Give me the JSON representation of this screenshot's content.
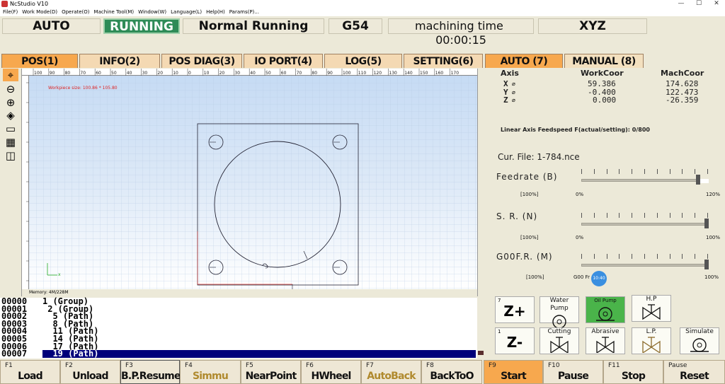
{
  "window": {
    "title": "NcStudio V10"
  },
  "menu": [
    "File(F)",
    "Work Mode(D)",
    "Operate(O)",
    "Machine Tool(M)",
    "Window(W)",
    "Language(L)",
    "Help(H)",
    "Params(P)..."
  ],
  "status": {
    "mode": "AUTO",
    "state": "RUNNING",
    "state_detail": "Normal Running",
    "coord": "G54",
    "time_label": "machining time",
    "time_value": "00:00:15",
    "axes": "XYZ"
  },
  "tabs_left": [
    "POS(1)",
    "INFO(2)",
    "POS DIAG(3)",
    "IO PORT(4)",
    "LOG(5)",
    "SETTING(6)"
  ],
  "tabs_right": [
    "AUTO (7)",
    "MANUAL (8)"
  ],
  "ruler_labels": [
    "100",
    "90",
    "80",
    "70",
    "60",
    "50",
    "40",
    "30",
    "20",
    "10",
    "0",
    "10",
    "20",
    "30",
    "40",
    "50",
    "60",
    "70",
    "80",
    "90",
    "100",
    "110",
    "120",
    "130",
    "140",
    "150",
    "160",
    "170"
  ],
  "canvas": {
    "workpiece": "Workpiece size: 100.86 * 105.80",
    "memory": "Memory: 4M/228M",
    "axis_x": "x"
  },
  "code_lines": [
    {
      "n": "00000",
      "t": "1 (Group)"
    },
    {
      "n": "00001",
      "t": " 2 (Group)"
    },
    {
      "n": "00002",
      "t": "  5 (Path)"
    },
    {
      "n": "00003",
      "t": "  8 (Path)"
    },
    {
      "n": "00004",
      "t": "  11 (Path)"
    },
    {
      "n": "00005",
      "t": "  14 (Path)"
    },
    {
      "n": "00006",
      "t": "  17 (Path)"
    },
    {
      "n": "00007",
      "t": "  19 (Path)"
    }
  ],
  "coords": {
    "h_axis": "Axis",
    "h_work": "WorkCoor",
    "h_mach": "MachCoor",
    "rows": [
      {
        "axis": "X",
        "work": "59.386",
        "mach": "174.628"
      },
      {
        "axis": "Y",
        "work": "-0.400",
        "mach": "122.473"
      },
      {
        "axis": "Z",
        "work": "0.000",
        "mach": "-26.359"
      }
    ]
  },
  "feed_info": "Linear Axis Feedspeed F(actual/setting):  0/800",
  "cur_file": "Cur. File: 1-784.nce",
  "sliders": [
    {
      "label": "Feedrate (B)",
      "left": "[100%]",
      "min": "0%",
      "max": "120%",
      "level": 0.93
    },
    {
      "label": "S. R. (N)",
      "left": "[100%]",
      "min": "0%",
      "max": "100%",
      "level": 1.0
    },
    {
      "label": "G00F.R. (M)",
      "left": "[100%]",
      "min": "G00 Fr",
      "max": "100%",
      "level": 1.0
    }
  ],
  "badge": "10:40",
  "buttons": {
    "zplus": {
      "num": "7",
      "label": "Z+"
    },
    "zminus": {
      "num": "1",
      "label": "Z-"
    },
    "water": "Water Pump",
    "oil": "Oil Pump",
    "hp": "H.P",
    "cutting": "Cutting",
    "abrasive": "Abrasive",
    "lp": "L.P.",
    "simulate": "Simulate"
  },
  "fkeys": [
    {
      "k": "F1",
      "n": "Load"
    },
    {
      "k": "F2",
      "n": "Unload"
    },
    {
      "k": "F3",
      "n": "B.P.Resume"
    },
    {
      "k": "F4",
      "n": "Simmu"
    },
    {
      "k": "F5",
      "n": "NearPoint"
    },
    {
      "k": "F6",
      "n": "HWheel"
    },
    {
      "k": "F7",
      "n": "AutoBack"
    },
    {
      "k": "F8",
      "n": "BackToO"
    },
    {
      "k": "F9",
      "n": "Start"
    },
    {
      "k": "F10",
      "n": "Pause"
    },
    {
      "k": "F11",
      "n": "Stop"
    },
    {
      "k": "Pause",
      "n": "Reset"
    }
  ],
  "colors": {
    "accent": "#f7a84e",
    "running": "#2e8b57",
    "selection": "#00007a",
    "oil_active": "#4ab44a",
    "badge": "#3a8fe0"
  }
}
